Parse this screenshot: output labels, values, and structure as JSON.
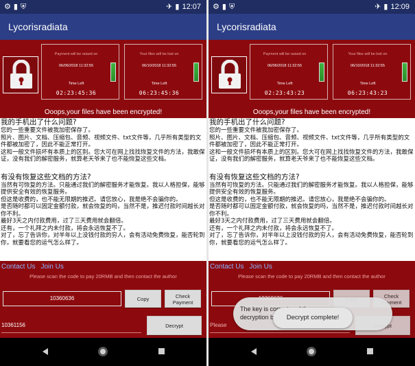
{
  "app": {
    "title": "Lycorisradiata"
  },
  "status": {
    "icons": [
      "gear-icon",
      "sim-icon",
      "shield-icon",
      "airplane-icon",
      "battery-icon"
    ],
    "left_time": "12:07",
    "right_time": "12:09"
  },
  "ransom": {
    "pay_label": "Payment will be raised on",
    "lost_label": "Your files will be lost on",
    "time_left_label": "Time Left",
    "left": {
      "pay_date": "06/06/2018 11:32:55",
      "lost_date": "06/10/2018 11:32:55",
      "pay_timer": "02:23:45:36",
      "lost_timer": "06:23:45:36"
    },
    "right": {
      "pay_date": "06/06/2018 11:32:55",
      "lost_date": "06/10/2018 11:32:55",
      "pay_timer": "02:23:43:23",
      "lost_timer": "06:23:43:23"
    },
    "encrypted_msg": "Ooops,your files have been encrypted!"
  },
  "content": {
    "heading1": "我的手机出了什么问题?",
    "para1": "您的一些重要文件被我加密保存了。",
    "para2": "照片、图片、文档、压缩包、音频、视频文件、txt文件等，几乎所有类型的文件都被加密了，因此不能正常打开。",
    "para3": "这和一般文件损坏有本质上的区别。您大可在网上找找恢复文件的方法，我敢保证，没有我们的解密服务，就算老天爷来了也不能恢复这些文档。",
    "heading2": "有没有恢复这些文档的方法?",
    "para4": "当然有可恢复的方法。只能通过我们的解密服务才能恢复。我以人格担保，能够提供安全有效的恢复服务。",
    "para5": "但这是收费的，也不能无限期的推迟。请您放心，我是绝不会骗你的。",
    "para6": "是否随时都可以固定金额付款，就会恢复的吗，当然不是，推迟付款时间越长对你不利。",
    "para7": "最好3天之内付款费用，过了三天费用就会翻倍。",
    "para8": "还有，一个礼拜之内未付款，将会永远恢复不了。",
    "para9": "对了，忘了告诉你，对半年以上没钱付款的穷人，会有活动免费恢复，能否轮到你，就要看您的运气怎么样了。"
  },
  "contact": {
    "contact_link": "Contact Us",
    "join_link": "Join Us",
    "scan_msg": "Please scan the code to pay 20RMB and then contact the author",
    "code_value": "10360636",
    "copy_label": "Copy",
    "check_label": "Check Payment",
    "left_key_value": "10361156",
    "right_key_placeholder": "Please",
    "decrypt_label": "Decrypt"
  },
  "overlay": {
    "dialog_text": "The key is correct and the decryption begins!",
    "toast_text": "Decrypt complete!"
  },
  "colors": {
    "status_bar": "#1f2d63",
    "app_bar": "#2c3e86",
    "ransom_bg": "#8c0a0e",
    "link": "#8fb3ff"
  }
}
